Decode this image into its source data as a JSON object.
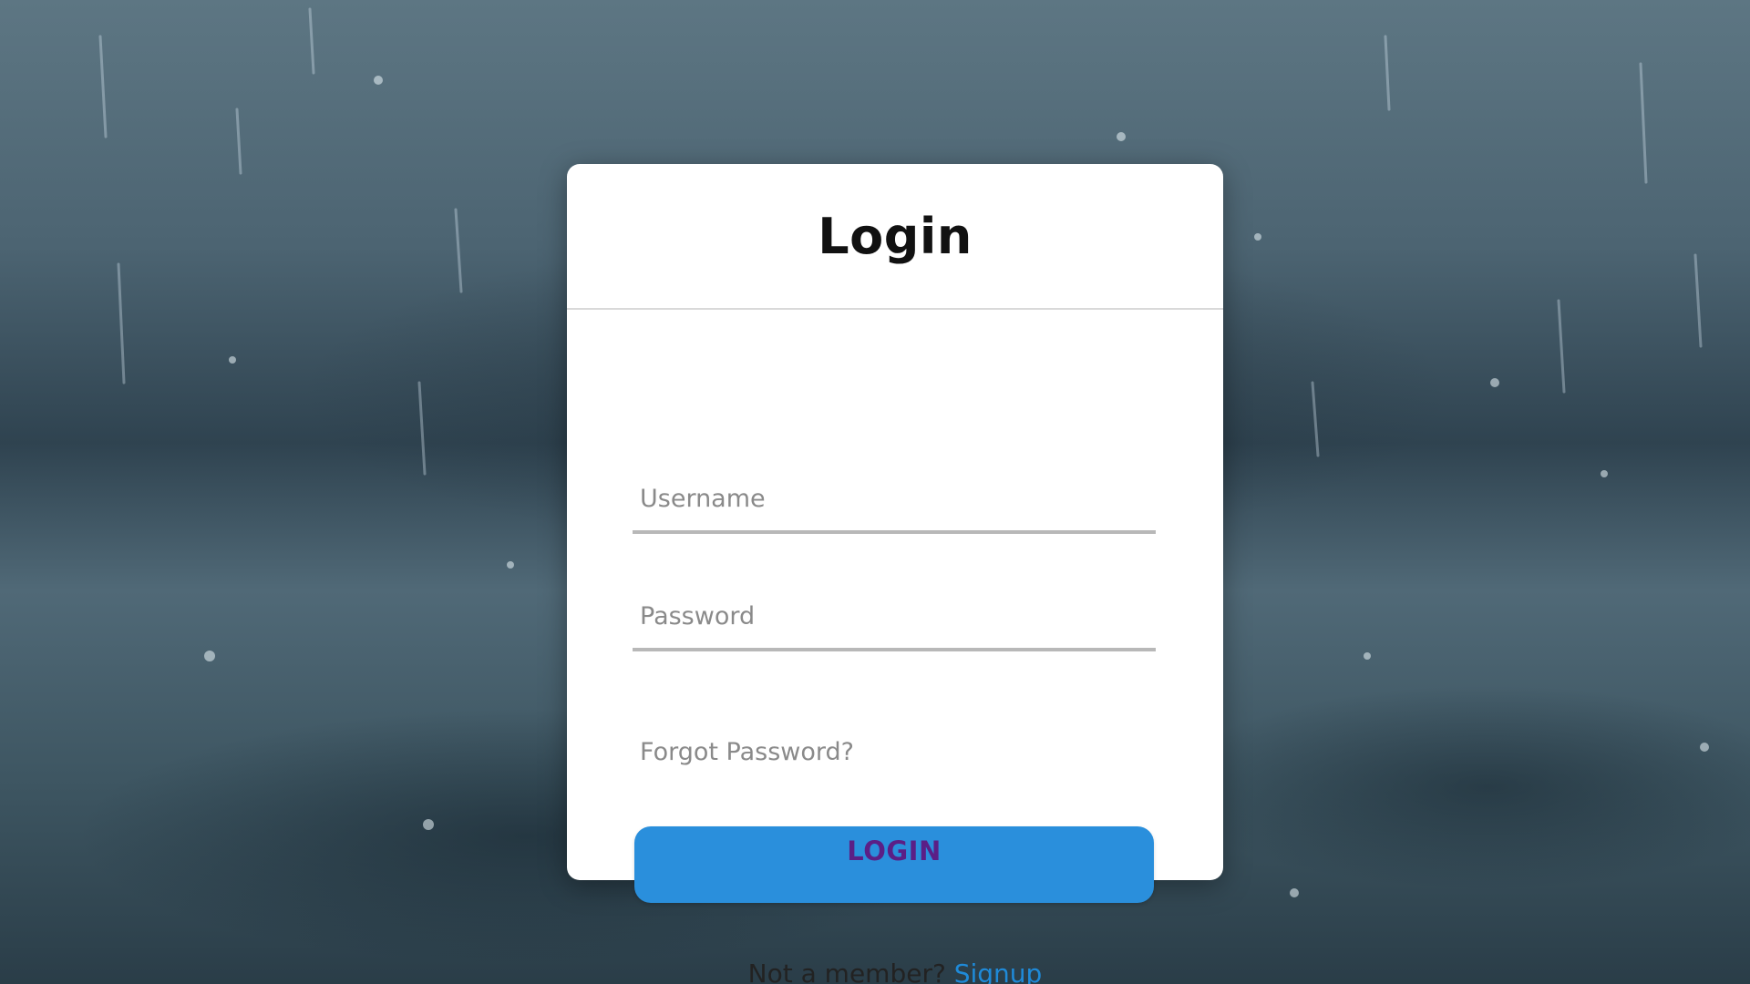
{
  "login_card": {
    "title": "Login",
    "username_placeholder": "Username",
    "username_value": "",
    "password_placeholder": "Password",
    "password_value": "",
    "forgot_password_label": "Forgot Password?",
    "login_button_label": "LOGIN",
    "signup_prompt": "Not a member?",
    "signup_link_label": "Signup"
  },
  "colors": {
    "accent": "#2a8fdc",
    "button_text": "#5b1f86",
    "link": "#1f8ad8",
    "card_background": "#ffffff"
  }
}
